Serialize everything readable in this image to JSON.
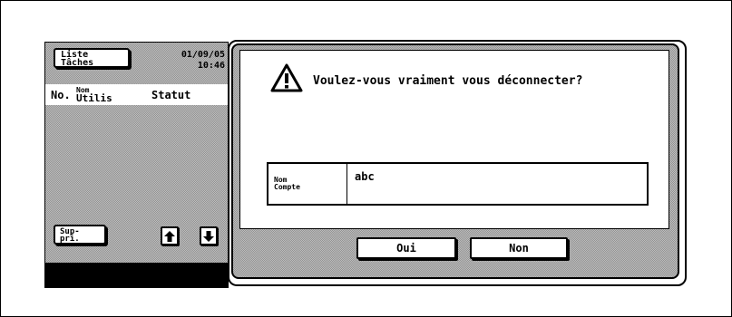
{
  "job_panel": {
    "job_list_label_line1": "Liste",
    "job_list_label_line2": "Tâches",
    "date": "01/09/05",
    "time": "10:46",
    "columns": {
      "no": "No.",
      "user_line1": "Nom",
      "user_line2": "Utilis",
      "status": "Statut"
    },
    "delete_label_line1": "Sup-",
    "delete_label_line2": "pri.",
    "up_arrow": "🡅",
    "down_arrow": "🡇"
  },
  "dialog": {
    "icon": "warning-icon",
    "message": "Voulez-vous vraiment vous déconnecter?",
    "account_label_line1": "Nom",
    "account_label_line2": "Compte",
    "account_value": "abc",
    "yes_label": "Oui",
    "no_label": "Non"
  }
}
